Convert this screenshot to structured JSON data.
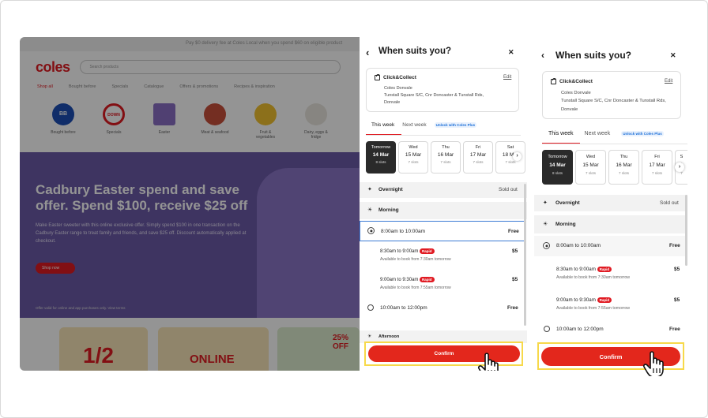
{
  "colors": {
    "brand": "#e01a22",
    "confirm": "#e3271c",
    "highlight": "#f7d94a",
    "selected_border": "#3c7bd4",
    "coles_plus": "#1c6fd8"
  },
  "background_site": {
    "notice": "Pay $0 delivery fee at Coles Local when you spend $60 on eligible product",
    "logo": "coles",
    "search_placeholder": "Search products",
    "nav": [
      "Shop all",
      "Bought before",
      "Specials",
      "Catalogue",
      "Offers & promotions",
      "Recipes & inspiration"
    ],
    "categories": [
      "Bought before",
      "Specials",
      "Easter",
      "Meat & seafood",
      "Fruit & vegetables",
      "Dairy, eggs & fridge"
    ],
    "category_badge": "BB",
    "specials_badge": "DOWN",
    "hero_title": "Cadbury Easter spend and save offer. Spend $100, receive $25 off",
    "hero_sub": "Make Easter sweeter with this online exclusive offer. Simply spend $100 in one transaction on the Cadbury Easter range to treat family and friends, and save $25 off. Discount automatically applied at checkout.",
    "hero_button": "Shop now",
    "hero_terms": "Offer valid for online and app purchases only. View terms",
    "promo_half": "1/2",
    "promo_online": "ONLINE",
    "promo_pct": "25% OFF"
  },
  "panel": {
    "back_icon": "‹",
    "close_icon": "✕",
    "title": "When suits you?",
    "store": {
      "method": "Click&Collect",
      "edit": "Edit",
      "name": "Coles Donvale",
      "address_1": "Tunstall Square S/C, Cnr Doncaster & Tunstall Rds,",
      "address_2": "Donvale"
    },
    "tabs": {
      "this_week": "This week",
      "next_week": "Next week",
      "badge": "Unlock with Coles Plus"
    },
    "days": [
      {
        "name": "Tomorrow",
        "date": "14 Mar",
        "slots": "8 slots"
      },
      {
        "name": "Wed",
        "date": "15 Mar",
        "slots": "7 slots"
      },
      {
        "name": "Thu",
        "date": "16 Mar",
        "slots": "7 slots"
      },
      {
        "name": "Fri",
        "date": "17 Mar",
        "slots": "7 slots"
      },
      {
        "name": "Sat",
        "date": "18 Mar",
        "slots": "7 slots"
      },
      {
        "name": "S",
        "date": "1",
        "slots": "7"
      }
    ],
    "day_arrow": "›",
    "overnight": {
      "label": "Overnight",
      "status": "Sold out"
    },
    "morning": {
      "label": "Morning"
    },
    "afternoon": {
      "label": "Afternoon"
    },
    "slots": [
      {
        "time": "8:00am to 10:00am",
        "price": "Free"
      },
      {
        "time": "8:30am to 9:00am",
        "badge": "Rapid",
        "avail": "Available to book from 7:30am tomorrow",
        "price": "$5"
      },
      {
        "time": "9:00am to 9:30am",
        "badge": "Rapid",
        "avail": "Available to book from 7:55am tomorrow",
        "price": "$5"
      },
      {
        "time": "10:00am to 12:00pm",
        "price": "Free"
      }
    ],
    "confirm": "Confirm"
  }
}
